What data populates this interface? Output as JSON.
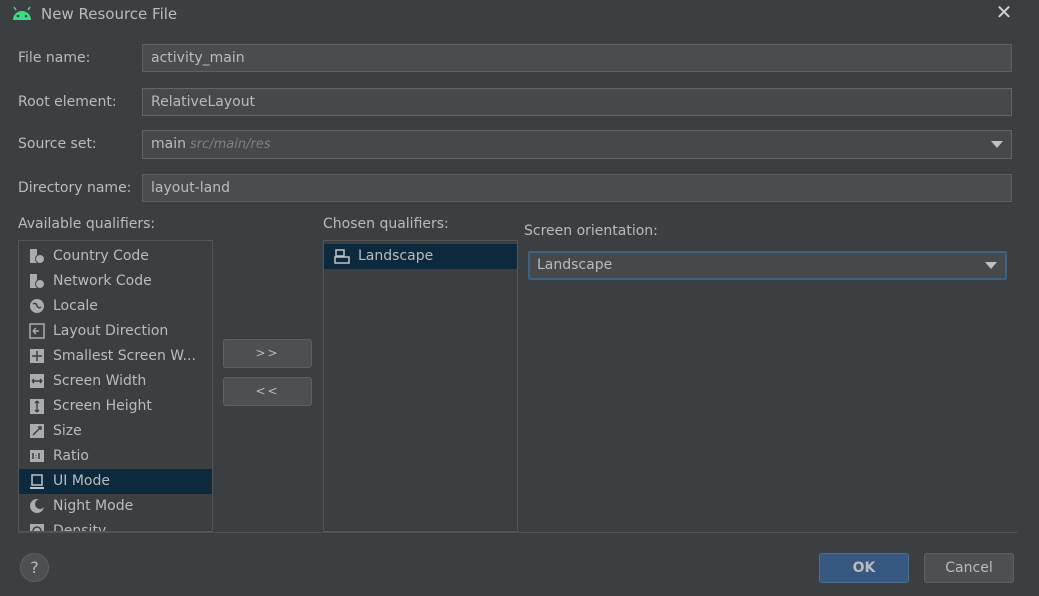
{
  "window": {
    "title": "New Resource File"
  },
  "form": {
    "file_name": {
      "label": "File name:",
      "value": "activity_main"
    },
    "root_element": {
      "label": "Root element:",
      "value": "RelativeLayout"
    },
    "source_set": {
      "label": "Source set:",
      "value": "main",
      "hint": "src/main/res"
    },
    "directory_name": {
      "label": "Directory name:",
      "value": "layout-land"
    }
  },
  "available_qualifiers": {
    "label": "Available qualifiers:",
    "items": [
      {
        "label": "Country Code",
        "icon": "country-code-icon"
      },
      {
        "label": "Network Code",
        "icon": "network-code-icon"
      },
      {
        "label": "Locale",
        "icon": "globe-icon"
      },
      {
        "label": "Layout Direction",
        "icon": "layout-direction-icon"
      },
      {
        "label": "Smallest Screen W...",
        "icon": "smallest-screen-icon"
      },
      {
        "label": "Screen Width",
        "icon": "screen-width-icon"
      },
      {
        "label": "Screen Height",
        "icon": "screen-height-icon"
      },
      {
        "label": "Size",
        "icon": "size-icon"
      },
      {
        "label": "Ratio",
        "icon": "ratio-icon"
      },
      {
        "label": "UI Mode",
        "icon": "ui-mode-icon",
        "selected": true
      },
      {
        "label": "Night Mode",
        "icon": "night-mode-icon"
      },
      {
        "label": "Density",
        "icon": "density-icon"
      }
    ]
  },
  "transfer_buttons": {
    "add": ">>",
    "remove": "<<"
  },
  "chosen_qualifiers": {
    "label": "Chosen qualifiers:",
    "items": [
      {
        "label": "Landscape",
        "icon": "landscape-icon",
        "selected": true
      }
    ]
  },
  "screen_orientation": {
    "label": "Screen orientation:",
    "value": "Landscape"
  },
  "footer": {
    "help": "?",
    "ok": "OK",
    "cancel": "Cancel"
  },
  "colors": {
    "accent": "#365880",
    "selection": "#0d293e",
    "background": "#3c3f41",
    "text": "#bbbbbb"
  }
}
